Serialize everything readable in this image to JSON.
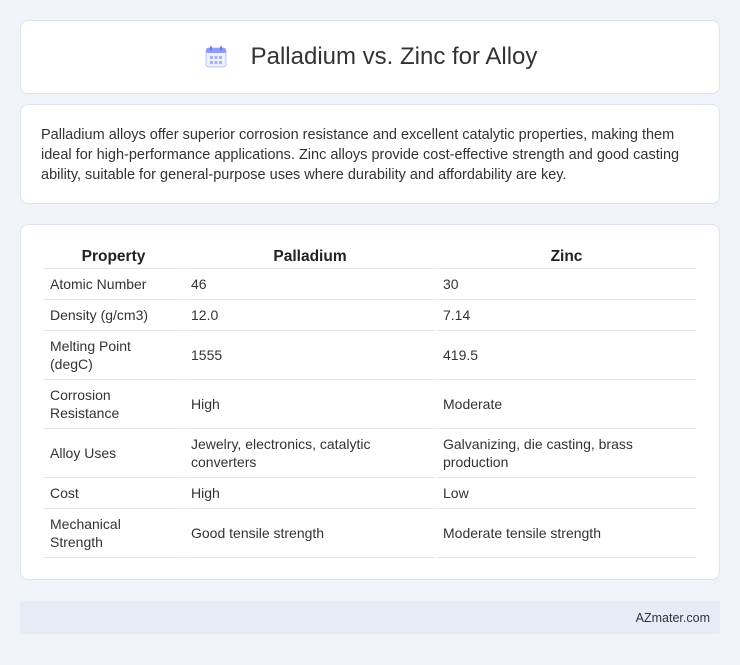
{
  "header": {
    "icon": "calendar-icon",
    "title": "Palladium vs. Zinc for Alloy"
  },
  "description": {
    "text": "Palladium alloys offer superior corrosion resistance and excellent catalytic properties, making them ideal for high-performance applications. Zinc alloys provide cost-effective strength and good casting ability, suitable for general-purpose uses where durability and affordability are key."
  },
  "table": {
    "headers": [
      "Property",
      "Palladium",
      "Zinc"
    ],
    "rows": [
      [
        "Atomic Number",
        "46",
        "30"
      ],
      [
        "Density (g/cm3)",
        "12.0",
        "7.14"
      ],
      [
        "Melting Point (degC)",
        "1555",
        "419.5"
      ],
      [
        "Corrosion Resistance",
        "High",
        "Moderate"
      ],
      [
        "Alloy Uses",
        "Jewelry, electronics, catalytic converters",
        "Galvanizing, die casting, brass production"
      ],
      [
        "Cost",
        "High",
        "Low"
      ],
      [
        "Mechanical Strength",
        "Good tensile strength",
        "Moderate tensile strength"
      ]
    ]
  },
  "footer": {
    "brand": "AZmater.com"
  },
  "colors": {
    "background": "#f0f3f8",
    "card": "#ffffff",
    "footer": "#e6ecf6",
    "icon_accent": "#7b8cf0"
  }
}
